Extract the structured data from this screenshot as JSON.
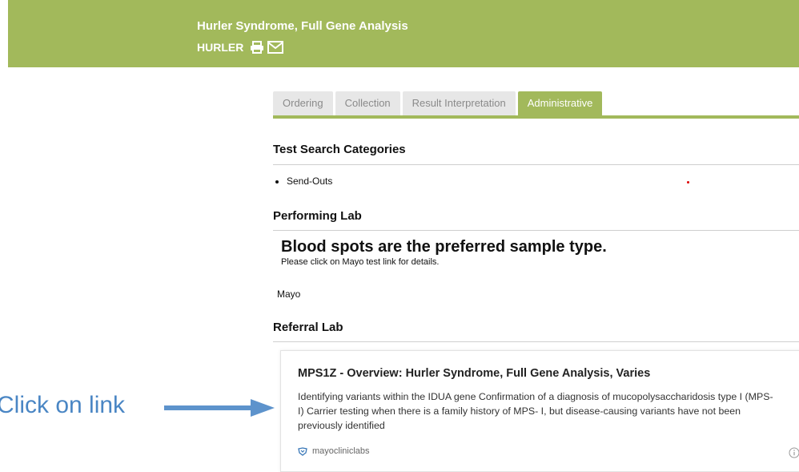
{
  "header": {
    "title": "Hurler Syndrome, Full Gene Analysis",
    "code": "HURLER",
    "print_icon": "printer-icon",
    "email_icon": "envelope-icon"
  },
  "tabs": [
    {
      "label": "Ordering",
      "active": false
    },
    {
      "label": "Collection",
      "active": false
    },
    {
      "label": "Result Interpretation",
      "active": false
    },
    {
      "label": "Administrative",
      "active": true
    }
  ],
  "sections": {
    "search_categories": {
      "heading": "Test Search Categories",
      "items": [
        "Send-Outs"
      ]
    },
    "performing_lab": {
      "heading": "Performing Lab",
      "note_big": "Blood spots are the preferred sample type.",
      "note_small": "Please click on Mayo test link for details.",
      "lab": "Mayo"
    },
    "referral_lab": {
      "heading": "Referral Lab"
    }
  },
  "link_card": {
    "title": "MPS1Z - Overview: Hurler Syndrome, Full Gene Analysis, Varies",
    "description": "Identifying variants within the IDUA gene Confirmation of a diagnosis of mucopolysaccharidosis type I (MPS-I) Carrier testing when there is a family history of MPS- I, but disease-causing variants have not been previously identified",
    "source": "mayocliniclabs",
    "info_icon": "info-icon"
  },
  "annotation": {
    "text": "Click on link",
    "color": "#4a86c4"
  },
  "colors": {
    "brand_green": "#a2b95b"
  }
}
